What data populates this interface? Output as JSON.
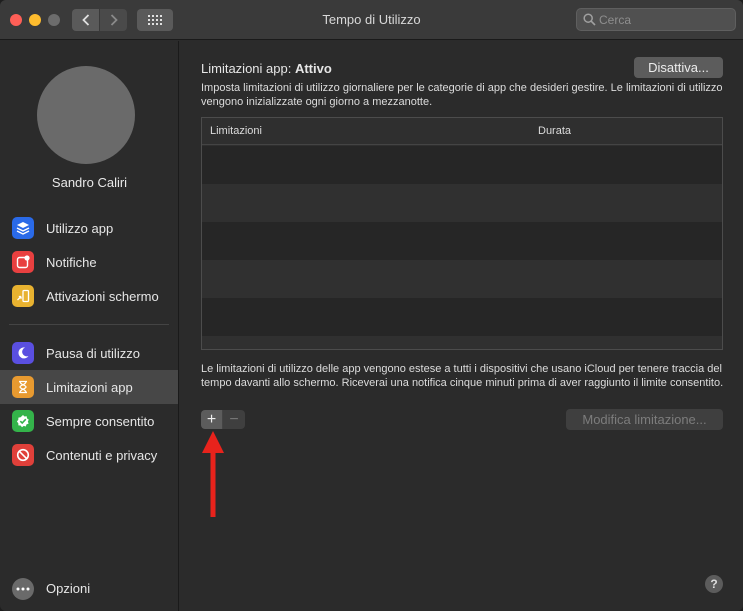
{
  "window": {
    "title": "Tempo di Utilizzo",
    "search_placeholder": "Cerca"
  },
  "sidebar": {
    "user_name": "Sandro Caliri",
    "items": [
      {
        "label": "Utilizzo app",
        "icon": "layers-icon",
        "color": "#2a6ae8"
      },
      {
        "label": "Notifiche",
        "icon": "notification-badge-icon",
        "color": "#e84040"
      },
      {
        "label": "Attivazioni schermo",
        "icon": "pickup-phone-icon",
        "color": "#e8b230"
      },
      {
        "label": "Pausa di utilizzo",
        "icon": "moon-icon",
        "color": "#5a4fe0"
      },
      {
        "label": "Limitazioni app",
        "icon": "hourglass-icon",
        "color": "#e89a30",
        "selected": true
      },
      {
        "label": "Sempre consentito",
        "icon": "checkmark-badge-icon",
        "color": "#34b34a"
      },
      {
        "label": "Contenuti e privacy",
        "icon": "no-entry-icon",
        "color": "#e0403a"
      }
    ],
    "options_label": "Opzioni"
  },
  "main": {
    "heading_prefix": "Limitazioni app:",
    "heading_status": "Attivo",
    "disable_button": "Disattiva...",
    "description": "Imposta limitazioni di utilizzo giornaliere per le categorie di app che desideri gestire. Le limitazioni di utilizzo vengono inizializzate ogni giorno a mezzanotte.",
    "table": {
      "columns": [
        "Limitazioni",
        "Durata"
      ],
      "rows": []
    },
    "note": "Le limitazioni di utilizzo delle app vengono estese a tutti i dispositivi che usano iCloud per tenere traccia del tempo davanti allo schermo. Riceverai una notifica cinque minuti prima di aver raggiunto il limite consentito.",
    "add_label": "+",
    "remove_label": "−",
    "edit_button": "Modifica limitazione...",
    "help_label": "?"
  },
  "colors": {
    "annotation_arrow": "#e8231c"
  }
}
